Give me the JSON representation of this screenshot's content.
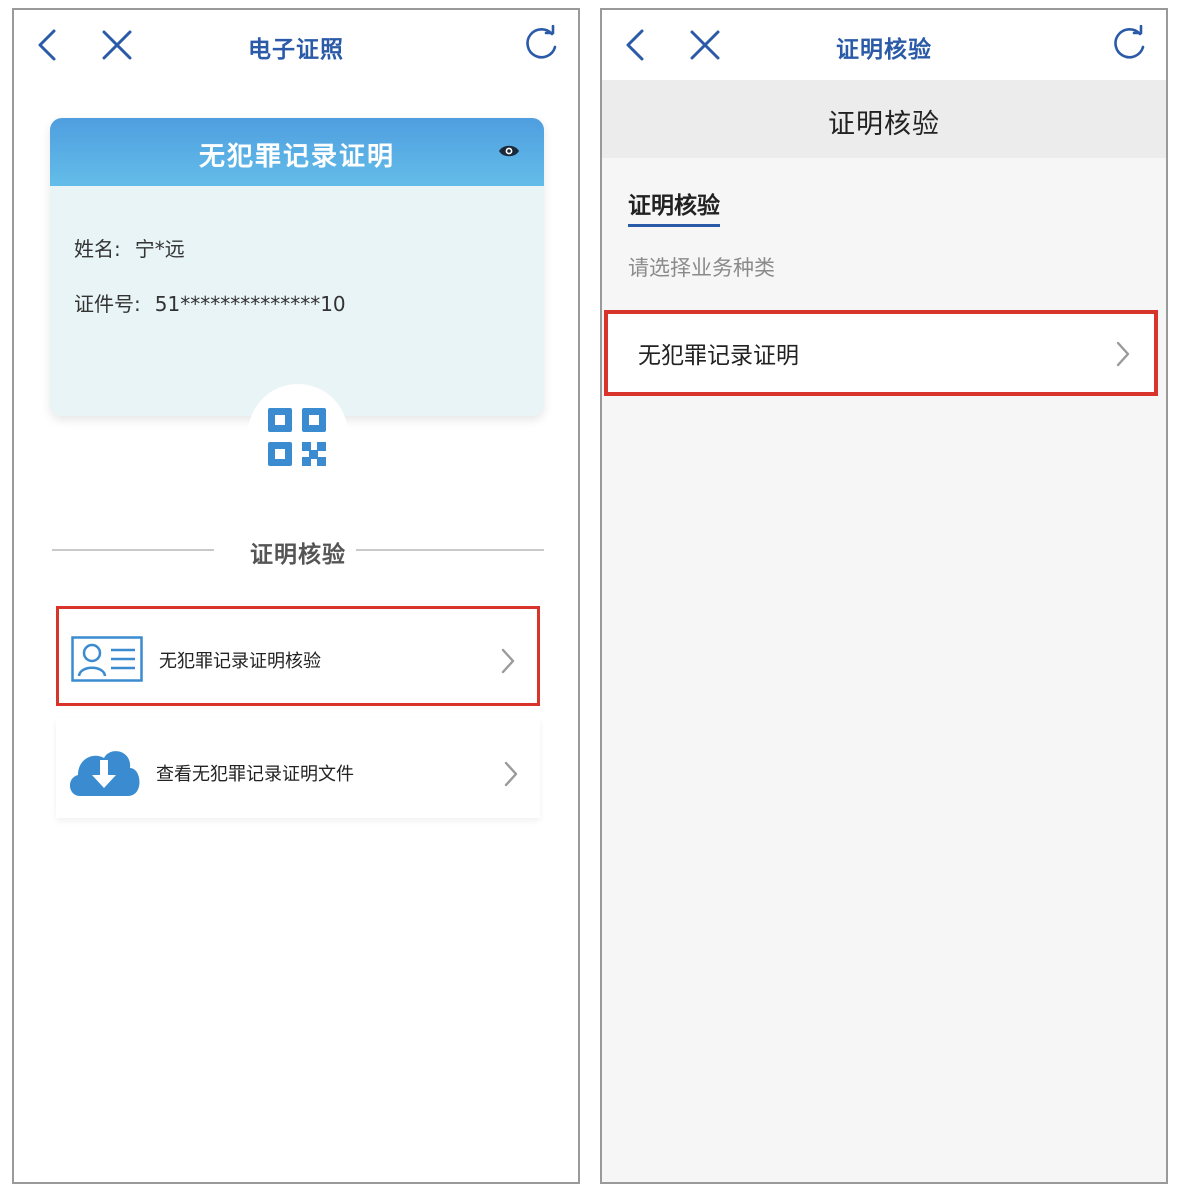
{
  "left": {
    "nav": {
      "title": "电子证照"
    },
    "card": {
      "title": "无犯罪记录证明",
      "name_label": "姓名:",
      "name_value": "宁*远",
      "id_label": "证件号:",
      "id_value": "51**************10"
    },
    "section": {
      "title": "证明核验"
    },
    "menu": [
      {
        "label": "无犯罪记录证明核验",
        "icon": "id-card-icon"
      },
      {
        "label": "查看无犯罪记录证明文件",
        "icon": "cloud-download-icon"
      }
    ]
  },
  "right": {
    "nav": {
      "title": "证明核验"
    },
    "header": {
      "title": "证明核验"
    },
    "tab": {
      "title": "证明核验"
    },
    "hint": "请选择业务种类",
    "options": [
      {
        "label": "无犯罪记录证明"
      }
    ]
  },
  "colors": {
    "accent_blue": "#2a5aa8",
    "highlight_red": "#d9342b",
    "card_header": "#4f9ee0",
    "icon_blue": "#3a8bd0"
  }
}
